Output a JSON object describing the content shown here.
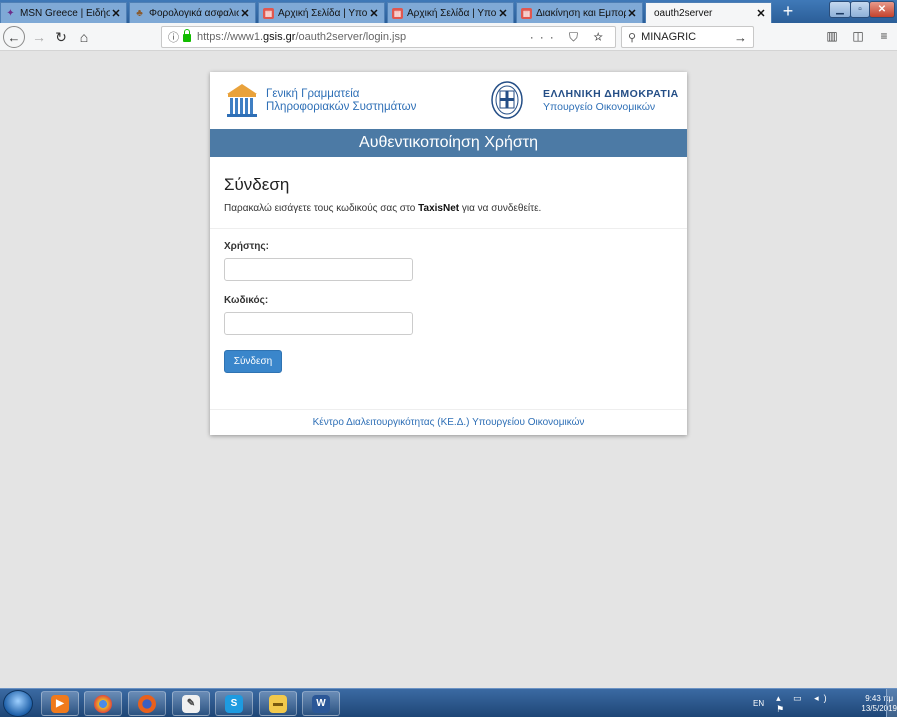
{
  "browser": {
    "tabs": [
      {
        "title": "MSN Greece | Ειδήσεις",
        "icon": "msn-icon",
        "color": "#6c2d8a"
      },
      {
        "title": "Φορολογικά ασφαλιστ",
        "icon": "palm-icon",
        "color": "#8a5a2d"
      },
      {
        "title": "Αρχική Σελίδα | Υπουρ",
        "icon": "ministry-icon",
        "color": "#e0574f"
      },
      {
        "title": "Αρχική Σελίδα | Υπουρ",
        "icon": "ministry-icon",
        "color": "#e0574f"
      },
      {
        "title": "Διακίνηση και Εμπορία",
        "icon": "ministry-icon",
        "color": "#e0574f"
      },
      {
        "title": "oauth2server",
        "icon": "",
        "color": ""
      }
    ],
    "active_tab_index": 5,
    "url_prefix": "https://www1.",
    "url_domain": "gsis.gr",
    "url_path": "/oauth2server/login.jsp",
    "search_value": "MINAGRIC"
  },
  "page": {
    "gsis_line1": "Γενική Γραμματεία",
    "gsis_line2": "Πληροφοριακών Συστημάτων",
    "gov_title": "ΕΛΛΗΝΙΚΗ ΔΗΜΟΚΡΑΤΙΑ",
    "gov_subtitle": "Υπουργείο Οικονομικών",
    "banner": "Αυθεντικοποίηση Χρήστη",
    "heading": "Σύνδεση",
    "desc_before": "Παρακαλώ εισάγετε τους κωδικούς σας στο ",
    "desc_bold": "TaxisNet",
    "desc_after": " για να συνδεθείτε.",
    "username_label": "Χρήστης:",
    "username_value": "",
    "password_label": "Κωδικός:",
    "password_value": "",
    "login_button": "Σύνδεση",
    "footer": "Κέντρο Διαλειτουργικότητας (ΚΕ.Δ.) Υπουργείου Οικονομικών",
    "brand_color": "#4c7aa5",
    "button_color": "#3a86cb"
  },
  "taskbar": {
    "apps": [
      {
        "name": "windows-media-player-icon",
        "color": "#f07a1c"
      },
      {
        "name": "chrome-icon",
        "color": "#e8b52a"
      },
      {
        "name": "firefox-icon",
        "color": "#e8601c"
      },
      {
        "name": "paint-icon",
        "color": "#f0f0f0"
      },
      {
        "name": "skype-icon",
        "color": "#1e9be0"
      },
      {
        "name": "folder-icon",
        "color": "#f2c94c"
      },
      {
        "name": "word-icon",
        "color": "#2b5797"
      }
    ],
    "language": "EN",
    "time": "9:43 πμ",
    "date": "13/5/2019"
  }
}
